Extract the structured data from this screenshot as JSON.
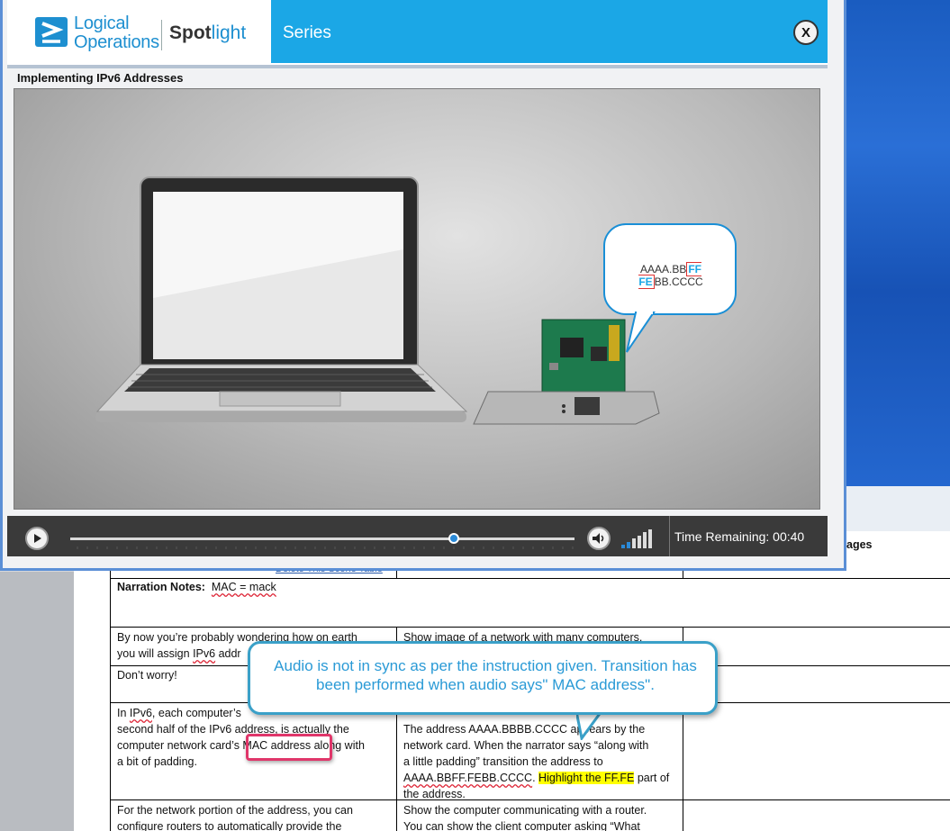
{
  "player": {
    "logo_line1": "Logical",
    "logo_line2": "Operations",
    "brand_spot": "Spot",
    "brand_light": "light",
    "series_label": "Series",
    "close_label": "X",
    "lesson_title": "Implementing IPv6 Addresses",
    "bubble": {
      "prefix": "AAAA.BB",
      "highlight": "FF FE",
      "suffix": "BB.CCCC"
    },
    "time_remaining": "Time Remaining: 00:40",
    "progress": 0.76
  },
  "doc": {
    "header_images": "ages",
    "delete_link": "Delete This Scene Table",
    "narration_label": "Narration Notes:",
    "narration_value": "MAC = mack",
    "rows": [
      {
        "left1": "By now you’re probably wondering how on earth",
        "left2a": "you will assign ",
        "left2b": "IPv6",
        "left2c": " addr",
        "right1": "Show image of a network with many computers."
      },
      {
        "left1": "Don’t worry!"
      },
      {
        "left1a": "In ",
        "left1b": "IPv6",
        "left1c": ", each computer’s ",
        "left2": "second half of the IPv6 address, is actually the",
        "left3": "computer network card’s MAC address along with",
        "left4": "a bit of padding.",
        "right1": "The address AAAA.BBBB.CCCC appears by the",
        "right2": "network card. When the narrator says “along with",
        "right3": "a little padding” transition the address to",
        "right4a": "AAAA.BBFF.FEBB.CCCC",
        "right4b": ". ",
        "right4c": "Highlight the FF.FE",
        "right4d": " part of",
        "right5": "the address."
      },
      {
        "left1": "For the network portion of the address, you can",
        "left2": "configure routers to automatically provide the",
        "right1": "Show the computer communicating with a router.",
        "right2": "You can show the client computer asking “What"
      }
    ]
  },
  "callout": {
    "text": "Audio is not in sync as per the instruction given. Transition has been performed when audio says\" MAC address\"."
  },
  "colors": {
    "brand_blue": "#1ba7e6",
    "callout_border": "#3aa0c8",
    "annotation_red": "#e0366a"
  }
}
